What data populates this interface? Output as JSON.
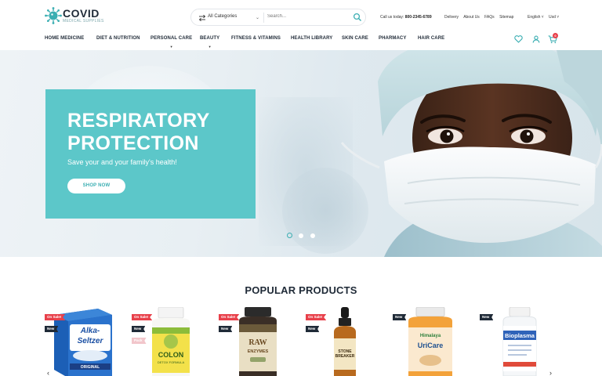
{
  "brand": {
    "name": "COVID",
    "tagline": "MEDICAL SUPPLIES"
  },
  "search": {
    "category": "All Categories",
    "placeholder": "Search..."
  },
  "topbar": {
    "call_label": "Call us today:",
    "call_number": "800-2345-6789",
    "links": [
      "Delivery",
      "About Us",
      "FAQs",
      "Sitemap"
    ],
    "language": "English",
    "currency": "Usd"
  },
  "nav": [
    {
      "label": "HOME MEDICINE",
      "has_dropdown": false
    },
    {
      "label": "DIET & NUTRITION",
      "has_dropdown": false
    },
    {
      "label": "PERSONAL CARE",
      "has_dropdown": true
    },
    {
      "label": "BEAUTY",
      "has_dropdown": true
    },
    {
      "label": "FITNESS & VITAMINS",
      "has_dropdown": false
    },
    {
      "label": "HEALTH LIBRARY",
      "has_dropdown": false
    },
    {
      "label": "SKIN CARE",
      "has_dropdown": false
    },
    {
      "label": "PHARMACY",
      "has_dropdown": false
    },
    {
      "label": "HAIR CARE",
      "has_dropdown": false
    }
  ],
  "cart": {
    "count": "0"
  },
  "hero": {
    "title_line1": "RESPIRATORY",
    "title_line2": "PROTECTION",
    "subtitle": "Save your and your family's health!",
    "button": "SHOP NOW",
    "slides": 3,
    "active_slide": 1
  },
  "products": {
    "title": "POPULAR PRODUCTS",
    "items": [
      {
        "badges": [
          "On Sale!",
          "New"
        ],
        "label_lines": [
          "Alka-",
          "Seltzer",
          "ORIGINAL"
        ]
      },
      {
        "badges": [
          "On Sale!",
          "New",
          "Pack"
        ],
        "label_lines": [
          "COLON",
          "DETOX FORMULA"
        ]
      },
      {
        "badges": [
          "On Sale!",
          "New"
        ],
        "label_lines": [
          "RAW",
          "ENZYMES"
        ]
      },
      {
        "badges": [
          "On Sale!",
          "New"
        ],
        "label_lines": [
          "STONE",
          "BREAKER"
        ]
      },
      {
        "badges": [
          "New"
        ],
        "label_lines": [
          "Himalaya",
          "UriCare"
        ]
      },
      {
        "badges": [
          "New"
        ],
        "label_lines": [
          "Bioplasma"
        ]
      }
    ]
  },
  "colors": {
    "accent": "#5cc7c9",
    "accent_dark": "#3aaeb2",
    "sale": "#e8404a",
    "dark": "#1f2a37"
  }
}
